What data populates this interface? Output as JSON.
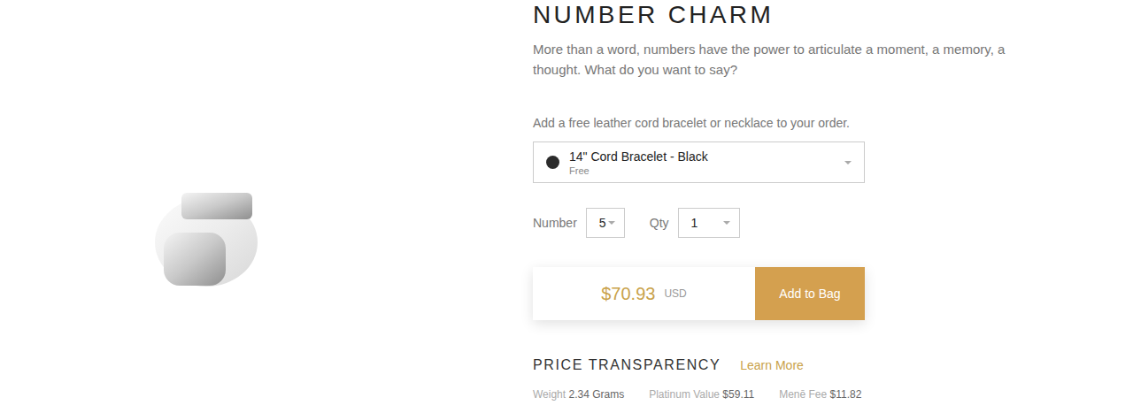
{
  "product": {
    "title": "NUMBER CHARM",
    "description": "More than a word, numbers have the power to articulate a moment, a memory, a thought. What do you want to say?"
  },
  "cord": {
    "prompt": "Add a free leather cord bracelet or necklace to your order.",
    "selected": {
      "label": "14\" Cord Bracelet - Black",
      "price": "Free",
      "color": "#2b2b2b"
    }
  },
  "options": [
    {
      "label": "Number",
      "value": "5"
    },
    {
      "label": "Qty",
      "value": "1"
    }
  ],
  "price": {
    "amount": "$70.93",
    "currency": "USD"
  },
  "button": "Add to Bag",
  "transparency": {
    "title": "PRICE TRANSPARENCY",
    "link": "Learn More",
    "items": [
      {
        "label": "Weight",
        "value": "2.34 Grams"
      },
      {
        "label": "Platinum Value",
        "value": "$59.11"
      },
      {
        "label": "Menē Fee",
        "value": "$11.82"
      }
    ]
  }
}
